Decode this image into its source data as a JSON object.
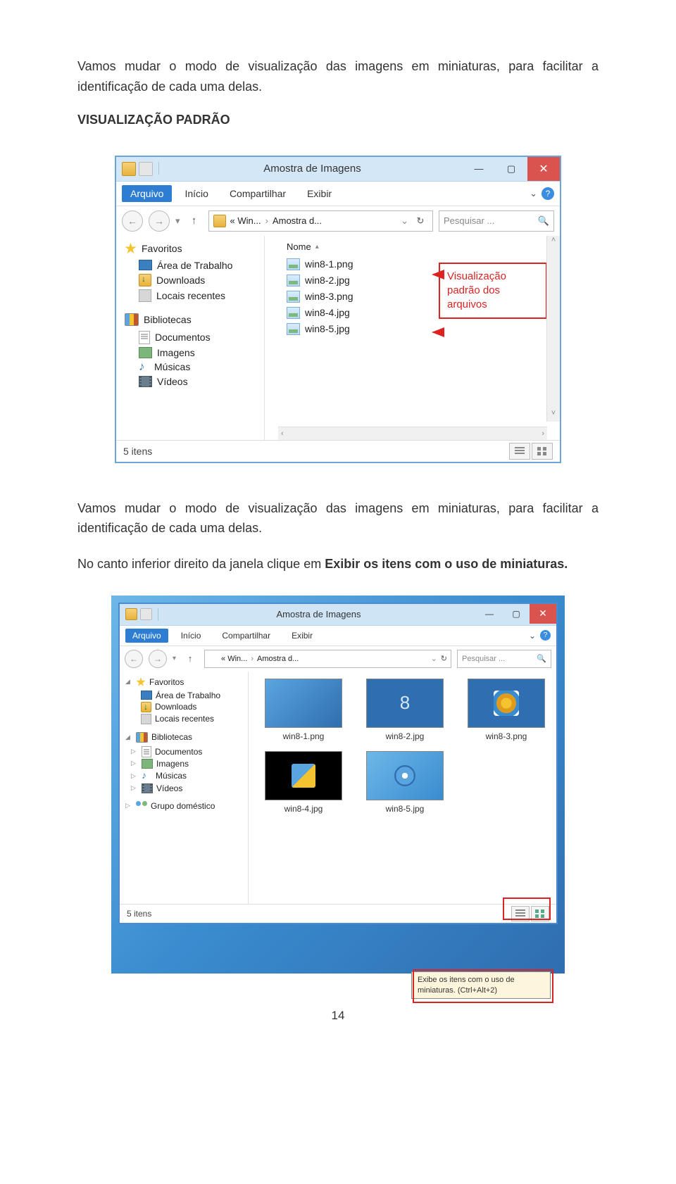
{
  "intro_para_a": "Vamos mudar o modo de visualização das imagens em miniaturas, para facilitar a identificação de cada uma delas.",
  "section_title": "VISUALIZAÇÃO PADRÃO",
  "mid_para": "Vamos mudar o modo de visualização das imagens em miniaturas, para facilitar a identificação de cada uma delas.",
  "instr_a": "No canto inferior direito da janela clique em ",
  "instr_b": "Exibir os itens com o uso de miniaturas.",
  "page_number": "14",
  "win1": {
    "title": "Amostra de Imagens",
    "ribbon": {
      "file": "Arquivo",
      "home": "Início",
      "share": "Compartilhar",
      "view": "Exibir"
    },
    "addr": {
      "seg1": "« Win...",
      "seg2": "Amostra d..."
    },
    "refresh": "↻",
    "search": "Pesquisar ...",
    "col_name": "Nome",
    "sidebar": {
      "fav": "Favoritos",
      "desktop": "Área de Trabalho",
      "downloads": "Downloads",
      "recent": "Locais recentes",
      "lib": "Bibliotecas",
      "docs": "Documentos",
      "imgs": "Imagens",
      "music": "Músicas",
      "videos": "Vídeos"
    },
    "files": [
      "win8-1.png",
      "win8-2.jpg",
      "win8-3.png",
      "win8-4.jpg",
      "win8-5.jpg"
    ],
    "callout": "Visualização padrão dos arquivos",
    "status": "5 itens"
  },
  "win2": {
    "title": "Amostra de Imagens",
    "ribbon": {
      "file": "Arquivo",
      "home": "Início",
      "share": "Compartilhar",
      "view": "Exibir"
    },
    "addr": {
      "seg1": "« Win...",
      "seg2": "Amostra d..."
    },
    "search": "Pesquisar ...",
    "sidebar": {
      "fav": "Favoritos",
      "desktop": "Área de Trabalho",
      "downloads": "Downloads",
      "recent": "Locais recentes",
      "lib": "Bibliotecas",
      "docs": "Documentos",
      "imgs": "Imagens",
      "music": "Músicas",
      "videos": "Vídeos",
      "homegroup": "Grupo doméstico"
    },
    "thumbs": [
      "win8-1.png",
      "win8-2.jpg",
      "win8-3.png",
      "win8-4.jpg",
      "win8-5.jpg"
    ],
    "t2_glyph": "8",
    "status": "5 itens",
    "tooltip": "Exibe os itens com o uso de miniaturas. (Ctrl+Alt+2)"
  }
}
